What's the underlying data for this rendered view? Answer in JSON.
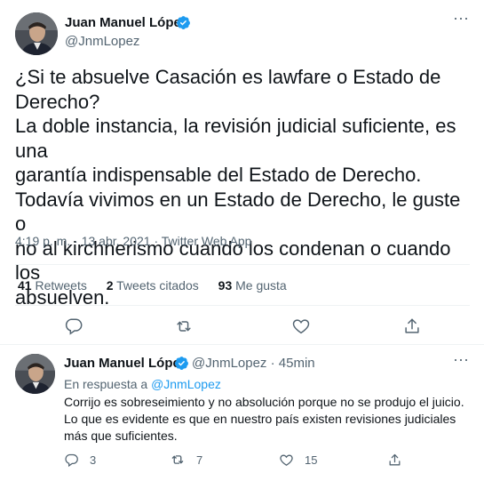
{
  "tweet": {
    "author_name": "Juan Manuel López",
    "author_handle": "@JnmLopez",
    "text_lines": [
      "¿Si te absuelve Casación es lawfare o Estado de",
      "Derecho?",
      "La doble instancia, la revisión judicial suficiente, es una",
      "garantía indispensable del Estado de Derecho.",
      "Todavía vivimos en un Estado de Derecho, le guste o",
      "no al kirchnerismo cuando los condenan o cuando los",
      "absuelven."
    ],
    "time": "4:19 p. m.",
    "separator": "·",
    "date": "13 abr. 2021",
    "app": "Twitter Web App",
    "stats": {
      "retweets_count": "41",
      "retweets_label": "Retweets",
      "quotes_count": "2",
      "quotes_label": "Tweets citados",
      "likes_count": "93",
      "likes_label": "Me gusta"
    }
  },
  "reply": {
    "author_name": "Juan Manuel López",
    "author_handle_time": "@JnmLopez · 45min",
    "reply_prefix": "En respuesta a ",
    "reply_to": "@JnmLopez",
    "text": "Corrijo es sobreseimiento y no absolución porque no se produjo el juicio. Lo que es evidente es que en nuestro país existen revisiones judiciales más que suficientes.",
    "replies_count": "3",
    "retweets_count": "7",
    "likes_count": "15"
  },
  "colors": {
    "verified": "#1d9bf0",
    "link": "#1d9bf0",
    "secondary_text": "#536471"
  },
  "icons": {
    "more": "more-icon",
    "verified": "verified-badge-icon",
    "reply": "reply-icon",
    "retweet": "retweet-icon",
    "like": "heart-icon",
    "share": "share-icon"
  }
}
